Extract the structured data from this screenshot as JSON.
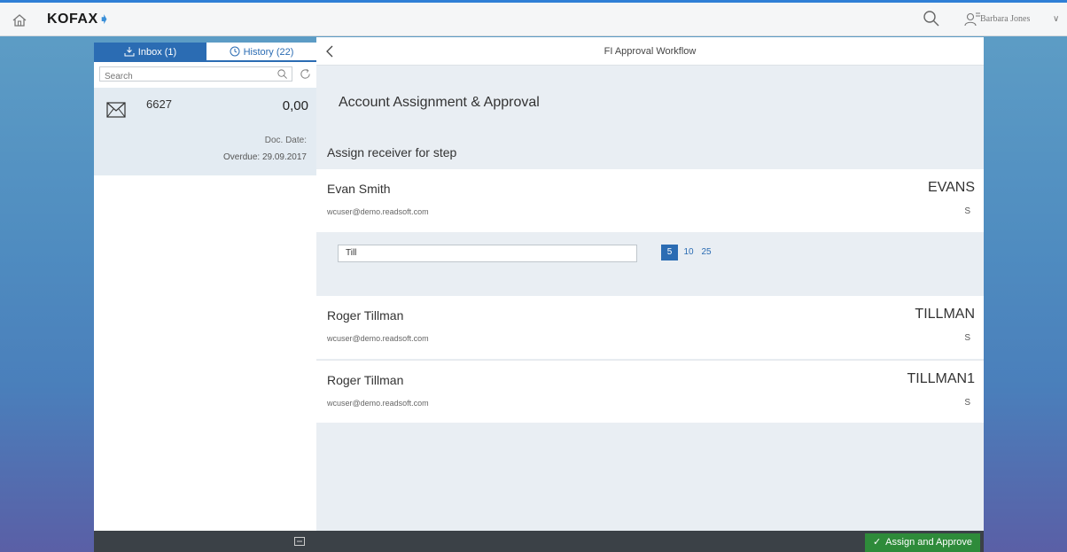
{
  "topbar": {
    "logo_text": "KOFAX",
    "logo_mark": "➧",
    "user_name": "Barbara Jones",
    "user_chevron": "∨"
  },
  "sidebar": {
    "tabs": [
      {
        "label": "Inbox (1)",
        "icon": "inbox-tray-icon",
        "active": true
      },
      {
        "label": "History (22)",
        "icon": "clock-icon",
        "active": false
      }
    ],
    "search_placeholder": "Search",
    "items": [
      {
        "id": "6627",
        "amount": "0,00",
        "doc_date": "Doc. Date:",
        "overdue": "Overdue: 29.09.2017",
        "icon": "envelope-icon"
      }
    ]
  },
  "main": {
    "title": "FI Approval Workflow",
    "section_title": "Account Assignment & Approval",
    "step_label": "Assign receiver for step",
    "filter": {
      "value": "Till",
      "page_sizes": [
        "5",
        "10",
        "25"
      ],
      "selected_page_size": "5"
    },
    "users": [
      {
        "name": "Evan Smith",
        "email": "wcuser@demo.readsoft.com",
        "code": "EVANS",
        "type": "S"
      },
      {
        "name": "Roger Tillman",
        "email": "wcuser@demo.readsoft.com",
        "code": "TILLMAN",
        "type": "S"
      },
      {
        "name": "Roger Tillman",
        "email": "wcuser@demo.readsoft.com",
        "code": "TILLMAN1",
        "type": "S"
      }
    ],
    "approve_label": "Assign and Approve",
    "approve_check": "✓"
  },
  "colors": {
    "accent": "#2b6cb3",
    "approve": "#2e8b3a",
    "footer": "#3b4147",
    "selected_item": "#e3ebf2"
  }
}
